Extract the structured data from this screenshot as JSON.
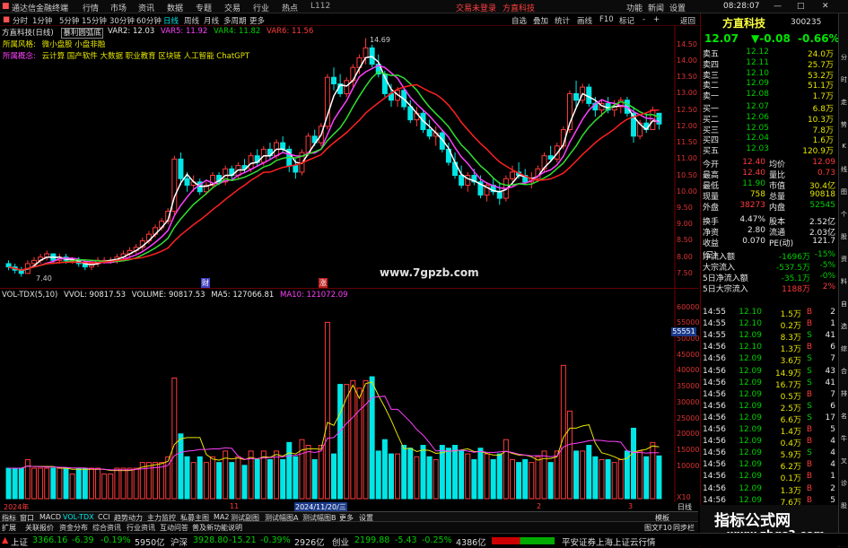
{
  "menubar": {
    "app_title": "通达信金融终端",
    "items": [
      "行情",
      "市场",
      "资讯",
      "数据",
      "专题",
      "交易",
      "行业",
      "热点",
      "L112"
    ],
    "center1": "交易未登录",
    "center2": "方直科技",
    "right": [
      "功能",
      "新闻",
      "设置"
    ],
    "time": "08:28:07"
  },
  "toolbar": {
    "periods": [
      "分时",
      "1分钟",
      "5分钟",
      "15分钟",
      "30分钟",
      "60分钟",
      "日线",
      "周线",
      "月线",
      "多周期",
      "更多"
    ],
    "active": "日线",
    "right": [
      "自选",
      "叠加",
      "统计",
      "画线",
      "F10",
      "标记",
      "-",
      "+",
      "返回"
    ]
  },
  "main": {
    "title": "方直科技(日线)",
    "indicator_name": "暴利圆弧底",
    "var2": "VAR2: 12.03",
    "var5": "VAR5: 11.92",
    "var4": "VAR4: 11.82",
    "var6": "VAR6: 11.56",
    "style_label": "所属风格:",
    "style_value": "微小盘股  小盘非融",
    "concept_label": "所属概念:",
    "concept_value": "云计算 国产软件 大数据 职业教育 区块链 人工智能 ChatGPT",
    "high_label": "14.69",
    "low_label": "7.40",
    "watermark": "www.7gpzb.com",
    "marker1": "财",
    "marker2": "涨",
    "yticks": [
      "14.50",
      "14.00",
      "13.50",
      "13.00",
      "12.50",
      "12.00",
      "11.50",
      "11.00",
      "10.50",
      "10.00",
      "9.50",
      "9.00",
      "8.50",
      "8.00",
      "7.50"
    ]
  },
  "volume": {
    "title": "VOL-TDX(5,10)",
    "vol": "VVOL: 90817.53",
    "vol2": "VOLUME: 90817.53",
    "ma5": "MA5: 127066.81",
    "ma10": "MA10: 121072.09",
    "yticks": [
      "60000",
      "55000",
      "50000",
      "45000",
      "40000",
      "35000",
      "30000",
      "25000",
      "20000",
      "15000",
      "10000",
      "X10"
    ],
    "highlight": "55551"
  },
  "xaxis": {
    "labels": [
      "2024年",
      "11",
      "2024/11/20/三",
      "2",
      "3"
    ],
    "right": "日线"
  },
  "tabs": [
    "指标",
    "窗口",
    "MACD",
    "VOL-TDX",
    "CCI",
    "趋势动力",
    "主力监控",
    "私募主图",
    "MA2",
    "测试副图",
    "测试幅图A",
    "测试幅图B",
    "更多",
    "设置"
  ],
  "tabs_right": "模板",
  "tabs2": [
    "扩展",
    "关联报价",
    "资金分布",
    "综合资讯",
    "行业资讯",
    "互动问答",
    "普及新功能说明"
  ],
  "tabs2_right": [
    "图文F10",
    "同步栏"
  ],
  "quote": {
    "name": "方直科技",
    "code": "300235",
    "price": "12.07",
    "change": "▼-0.08",
    "pct": "-0.66%",
    "asks": [
      [
        "卖五",
        "12.12",
        "24.0万"
      ],
      [
        "卖四",
        "12.11",
        "25.7万"
      ],
      [
        "卖三",
        "12.10",
        "53.2万"
      ],
      [
        "卖二",
        "12.09",
        "51.1万"
      ],
      [
        "卖一",
        "12.08",
        "1.7万"
      ]
    ],
    "bids": [
      [
        "买一",
        "12.07",
        "6.8万"
      ],
      [
        "买二",
        "12.06",
        "10.3万"
      ],
      [
        "买三",
        "12.05",
        "7.8万"
      ],
      [
        "买四",
        "12.04",
        "1.6万"
      ],
      [
        "买五",
        "12.03",
        "120.9万"
      ]
    ],
    "stats": [
      [
        "今开",
        "12.40",
        "均价",
        "12.09"
      ],
      [
        "最高",
        "12.40",
        "量比",
        "0.73"
      ],
      [
        "最低",
        "11.90",
        "市值",
        "30.4亿"
      ],
      [
        "现量",
        "758",
        "总量",
        "90818"
      ],
      [
        "外盘",
        "38273",
        "内盘",
        "52545"
      ]
    ],
    "stats2": [
      [
        "换手",
        "4.47%",
        "股本",
        "2.52亿"
      ],
      [
        "净资",
        "2.80",
        "流通",
        "2.03亿"
      ],
      [
        "收益(三)",
        "0.070",
        "PE(动)",
        "121.7"
      ]
    ],
    "flows": [
      [
        "净流入额",
        "-1696万",
        "-15%"
      ],
      [
        "大宗流入",
        "-537.5万",
        "-5%"
      ],
      [
        "5日净流入额",
        "-35.1万",
        "-0%"
      ],
      [
        "5日大宗流入",
        "1188万",
        "2%"
      ]
    ],
    "ticks": [
      [
        "14:55",
        "12.10",
        "1.5万",
        "B",
        "2"
      ],
      [
        "14:55",
        "12.10",
        "0.2万",
        "B",
        "1"
      ],
      [
        "14:55",
        "12.09",
        "8.3万",
        "S",
        "41"
      ],
      [
        "14:56",
        "12.10",
        "1.3万",
        "B",
        "6"
      ],
      [
        "14:56",
        "12.09",
        "3.6万",
        "S",
        "7"
      ],
      [
        "14:56",
        "12.09",
        "14.9万",
        "S",
        "43"
      ],
      [
        "14:56",
        "12.09",
        "16.7万",
        "S",
        "41"
      ],
      [
        "14:56",
        "12.09",
        "0.5万",
        "B",
        "7"
      ],
      [
        "14:56",
        "12.09",
        "2.5万",
        "S",
        "6"
      ],
      [
        "14:56",
        "12.09",
        "6.6万",
        "S",
        "17"
      ],
      [
        "14:56",
        "12.09",
        "1.4万",
        "B",
        "5"
      ],
      [
        "14:56",
        "12.09",
        "0.4万",
        "B",
        "4"
      ],
      [
        "14:56",
        "12.09",
        "5.9万",
        "S",
        "4"
      ],
      [
        "14:56",
        "12.09",
        "6.2万",
        "B",
        "4"
      ],
      [
        "14:56",
        "12.09",
        "0.1万",
        "B",
        "1"
      ],
      [
        "14:56",
        "12.09",
        "1.3万",
        "B",
        "2"
      ],
      [
        "14:56",
        "12.09",
        "7.6万",
        "B",
        "5"
      ]
    ]
  },
  "status": {
    "sh_label": "上证",
    "sh": "3366.16",
    "sh_chg": "-6.39",
    "sh_pct": "-0.19%",
    "sh_amt": "5950亿",
    "sz_label": "沪深",
    "sz": "3928.80",
    "sz_chg": "-15.21",
    "sz_pct": "-0.39%",
    "sz_amt": "2926亿",
    "cy_label": "创业",
    "cy": "2199.88",
    "cy_chg": "-5.43",
    "cy_pct": "-0.25%",
    "cy_amt": "4386亿",
    "broker": "平安证券上海上证云行情"
  },
  "brand": {
    "title": "指标公式网",
    "url": "www.zbgs3.com"
  },
  "sidebar": [
    "分",
    "时",
    "走",
    "势",
    "K",
    "线",
    "图",
    "个",
    "股",
    "资",
    "料",
    "自",
    "选",
    "综",
    "合",
    "排",
    "名",
    "牛",
    "叉",
    "诊",
    "股"
  ],
  "chart_data": {
    "type": "candlestick+volume",
    "price_series": "daily OHLC, range 7.40-14.69",
    "candles": [
      [
        7.8,
        7.9,
        7.6,
        7.7
      ],
      [
        7.7,
        7.8,
        7.5,
        7.6
      ],
      [
        7.6,
        7.7,
        7.4,
        7.5
      ],
      [
        7.5,
        7.9,
        7.5,
        7.8
      ],
      [
        7.8,
        8.0,
        7.7,
        7.9
      ],
      [
        7.9,
        8.1,
        7.8,
        8.0
      ],
      [
        8.0,
        8.2,
        7.9,
        8.1
      ],
      [
        8.1,
        8.0,
        7.8,
        7.9
      ],
      [
        7.9,
        8.1,
        7.8,
        8.0
      ],
      [
        8.0,
        8.1,
        7.8,
        7.9
      ],
      [
        7.9,
        8.0,
        7.8,
        7.9
      ],
      [
        7.9,
        8.0,
        7.7,
        7.8
      ],
      [
        7.8,
        7.9,
        7.6,
        7.7
      ],
      [
        7.7,
        7.9,
        7.6,
        7.8
      ],
      [
        7.8,
        8.0,
        7.7,
        7.9
      ],
      [
        7.9,
        8.0,
        7.8,
        7.9
      ],
      [
        7.9,
        8.0,
        7.8,
        7.9
      ],
      [
        7.9,
        8.1,
        7.8,
        8.0
      ],
      [
        8.0,
        8.2,
        7.9,
        8.1
      ],
      [
        8.1,
        8.3,
        8.0,
        8.2
      ],
      [
        8.2,
        8.4,
        8.1,
        8.3
      ],
      [
        8.3,
        8.6,
        8.2,
        8.5
      ],
      [
        8.5,
        8.8,
        8.4,
        8.7
      ],
      [
        8.7,
        9.0,
        8.6,
        8.9
      ],
      [
        8.9,
        9.2,
        8.8,
        9.1
      ],
      [
        9.1,
        9.5,
        9.0,
        9.4
      ],
      [
        9.4,
        11.1,
        9.3,
        11.0
      ],
      [
        11.0,
        11.2,
        10.2,
        10.4
      ],
      [
        10.4,
        10.6,
        10.0,
        10.2
      ],
      [
        10.2,
        10.5,
        10.0,
        10.3
      ],
      [
        10.3,
        10.4,
        9.9,
        10.0
      ],
      [
        10.0,
        10.3,
        9.9,
        10.2
      ],
      [
        10.2,
        10.6,
        10.1,
        10.5
      ],
      [
        10.5,
        10.6,
        10.2,
        10.3
      ],
      [
        10.3,
        10.8,
        10.2,
        10.7
      ],
      [
        10.7,
        10.8,
        10.4,
        10.5
      ],
      [
        10.5,
        10.9,
        10.4,
        10.8
      ],
      [
        10.8,
        11.0,
        10.6,
        10.7
      ],
      [
        10.7,
        11.2,
        10.6,
        11.1
      ],
      [
        11.1,
        11.3,
        10.8,
        10.9
      ],
      [
        10.9,
        11.4,
        10.8,
        11.3
      ],
      [
        11.3,
        11.5,
        11.0,
        11.1
      ],
      [
        11.1,
        11.6,
        11.0,
        11.5
      ],
      [
        11.5,
        11.7,
        11.2,
        11.3
      ],
      [
        11.3,
        11.4,
        10.6,
        10.8
      ],
      [
        10.8,
        11.0,
        10.4,
        10.6
      ],
      [
        10.6,
        11.3,
        10.5,
        11.2
      ],
      [
        11.2,
        11.8,
        11.1,
        11.7
      ],
      [
        11.7,
        11.9,
        11.4,
        11.5
      ],
      [
        11.5,
        12.1,
        11.4,
        12.0
      ],
      [
        12.0,
        13.6,
        11.9,
        13.5
      ],
      [
        13.5,
        13.8,
        13.1,
        13.3
      ],
      [
        13.3,
        13.6,
        12.9,
        13.0
      ],
      [
        13.0,
        13.5,
        12.9,
        13.4
      ],
      [
        13.4,
        13.9,
        13.2,
        13.8
      ],
      [
        13.8,
        14.2,
        13.6,
        14.1
      ],
      [
        14.1,
        14.7,
        13.9,
        14.4
      ],
      [
        14.4,
        14.5,
        13.8,
        13.9
      ],
      [
        13.9,
        14.2,
        13.5,
        13.6
      ],
      [
        13.6,
        13.7,
        12.9,
        13.0
      ],
      [
        13.0,
        13.3,
        12.6,
        12.8
      ],
      [
        12.8,
        13.2,
        12.6,
        13.1
      ],
      [
        13.1,
        13.2,
        12.5,
        12.6
      ],
      [
        12.6,
        12.8,
        12.1,
        12.2
      ],
      [
        12.2,
        12.6,
        12.0,
        12.4
      ],
      [
        12.4,
        12.5,
        11.8,
        11.9
      ],
      [
        11.9,
        12.2,
        11.6,
        11.7
      ],
      [
        11.7,
        12.0,
        11.4,
        11.8
      ],
      [
        11.8,
        11.9,
        11.2,
        11.3
      ],
      [
        11.3,
        11.5,
        10.8,
        10.9
      ],
      [
        10.9,
        11.2,
        10.4,
        10.5
      ],
      [
        10.5,
        10.8,
        10.1,
        10.2
      ],
      [
        10.2,
        10.6,
        10.0,
        10.5
      ],
      [
        10.5,
        10.7,
        10.2,
        10.3
      ],
      [
        10.3,
        10.5,
        9.8,
        9.9
      ],
      [
        9.9,
        10.3,
        9.7,
        10.2
      ],
      [
        10.2,
        10.4,
        9.9,
        10.0
      ],
      [
        10.0,
        10.3,
        9.6,
        9.8
      ],
      [
        9.8,
        10.5,
        9.7,
        10.4
      ],
      [
        10.4,
        10.8,
        10.3,
        10.6
      ],
      [
        10.6,
        10.9,
        10.4,
        10.5
      ],
      [
        10.5,
        10.7,
        10.2,
        10.3
      ],
      [
        10.3,
        10.6,
        10.1,
        10.4
      ],
      [
        10.4,
        10.8,
        10.3,
        10.7
      ],
      [
        10.7,
        11.2,
        10.6,
        11.1
      ],
      [
        11.1,
        11.4,
        10.9,
        11.0
      ],
      [
        11.0,
        11.5,
        10.9,
        11.4
      ],
      [
        11.4,
        12.0,
        11.3,
        11.9
      ],
      [
        11.9,
        13.1,
        11.8,
        13.0
      ],
      [
        13.0,
        13.4,
        12.6,
        12.8
      ],
      [
        12.8,
        13.3,
        12.7,
        13.2
      ],
      [
        13.2,
        13.3,
        12.6,
        12.7
      ],
      [
        12.7,
        12.9,
        12.3,
        12.5
      ],
      [
        12.5,
        12.8,
        12.3,
        12.7
      ],
      [
        12.7,
        12.9,
        12.4,
        12.5
      ],
      [
        12.5,
        12.8,
        12.3,
        12.6
      ],
      [
        12.6,
        12.9,
        12.4,
        12.8
      ],
      [
        12.8,
        12.9,
        12.3,
        12.4
      ],
      [
        12.4,
        12.6,
        11.5,
        11.7
      ],
      [
        11.7,
        12.2,
        11.6,
        12.1
      ],
      [
        12.1,
        12.4,
        11.8,
        11.9
      ],
      [
        11.9,
        12.6,
        11.9,
        12.5
      ],
      [
        12.4,
        12.4,
        11.9,
        12.07
      ]
    ],
    "volume_note": "daily volume bars, peaks ~55551 near late Nov 2024"
  }
}
